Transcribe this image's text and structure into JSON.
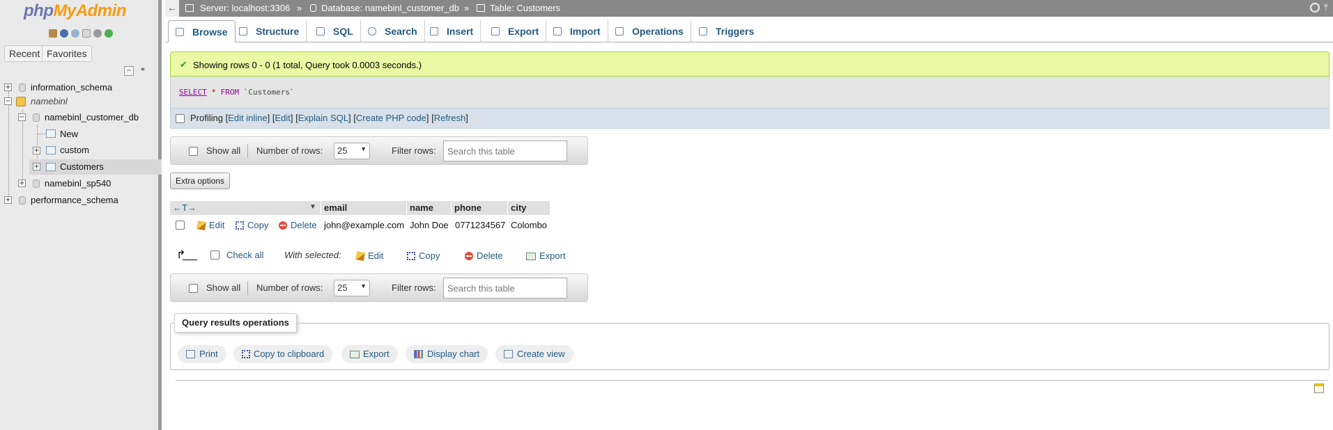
{
  "sidebar": {
    "logo_php": "php",
    "logo_myadmin": "MyAdmin",
    "recent_label": "Recent",
    "favorites_label": "Favorites",
    "collapse_label": "−",
    "link_label": "⚭",
    "tree": {
      "information_schema": "information_schema",
      "namebinl": "namebinl",
      "namebinl_customer_db": "namebinl_customer_db",
      "new_label": "New",
      "custom": "custom",
      "customers": "Customers",
      "namebinl_sp540": "namebinl_sp540",
      "performance_schema": "performance_schema"
    }
  },
  "breadcrumb": {
    "back": "←",
    "server": "Server: localhost:3306",
    "sep": "»",
    "database": "Database: namebinl_customer_db",
    "table": "Table: Customers"
  },
  "tabs": [
    "Browse",
    "Structure",
    "SQL",
    "Search",
    "Insert",
    "Export",
    "Import",
    "Operations",
    "Triggers"
  ],
  "message": {
    "check": "✔",
    "text": "Showing rows 0 - 0 (1 total, Query took 0.0003 seconds.)"
  },
  "sql": {
    "select": "SELECT",
    "star": "*",
    "from": "FROM",
    "table": "`Customers`"
  },
  "profiling": {
    "label": "Profiling",
    "lb": "[",
    "rb": "]",
    "edit_inline": "Edit inline",
    "edit": "Edit",
    "explain": "Explain SQL",
    "php": "Create PHP code",
    "refresh": "Refresh"
  },
  "nav": {
    "show_all": "Show all",
    "number_of_rows": "Number of rows:",
    "rows_value": "25",
    "filter_rows": "Filter rows:",
    "search_placeholder": "Search this table"
  },
  "extra_options": "Extra options",
  "table": {
    "arrows": "←T→",
    "sort_icon": "▼",
    "columns": [
      "email",
      "name",
      "phone",
      "city"
    ],
    "rows": [
      {
        "email": "john@example.com",
        "name": "John Doe",
        "phone": "0771234567",
        "city": "Colombo"
      }
    ],
    "row_actions": {
      "edit": "Edit",
      "copy": "Copy",
      "delete": "Delete"
    }
  },
  "bulk": {
    "arrow": "↱",
    "check_all": "Check all",
    "with_selected": "With selected:",
    "edit": "Edit",
    "copy": "Copy",
    "delete": "Delete",
    "export": "Export"
  },
  "query_ops": {
    "legend": "Query results operations",
    "buttons": [
      "Print",
      "Copy to clipboard",
      "Export",
      "Display chart",
      "Create view"
    ]
  },
  "colors": {
    "accent": "#235a81",
    "success_bg": "#ebf8a4",
    "topbar": "#888888"
  }
}
